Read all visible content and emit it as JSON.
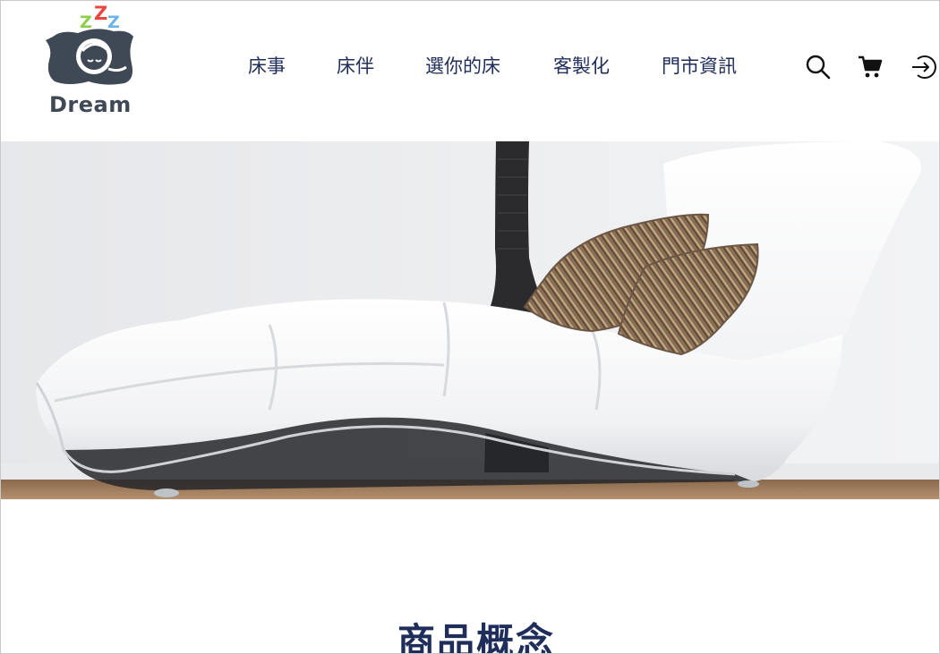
{
  "brand": {
    "name": "Dream",
    "zzz": [
      "Z",
      "Z",
      "Z"
    ],
    "zzz_colors": [
      "#8ccf4d",
      "#e8473f",
      "#6ab4e8"
    ]
  },
  "nav": {
    "items": [
      {
        "label": "床事"
      },
      {
        "label": "床伴"
      },
      {
        "label": "選你的床"
      },
      {
        "label": "客製化"
      },
      {
        "label": "門市資訊"
      }
    ]
  },
  "toolbar": {
    "icons": [
      "search-icon",
      "cart-icon",
      "login-icon"
    ]
  },
  "hero": {
    "image": "white-chaise-lounge-with-striped-pillows"
  },
  "section": {
    "title": "商品概念"
  },
  "colors": {
    "nav_text": "#1f2d5a",
    "title": "#1f2d5a",
    "logo_gray": "#3f4855"
  }
}
